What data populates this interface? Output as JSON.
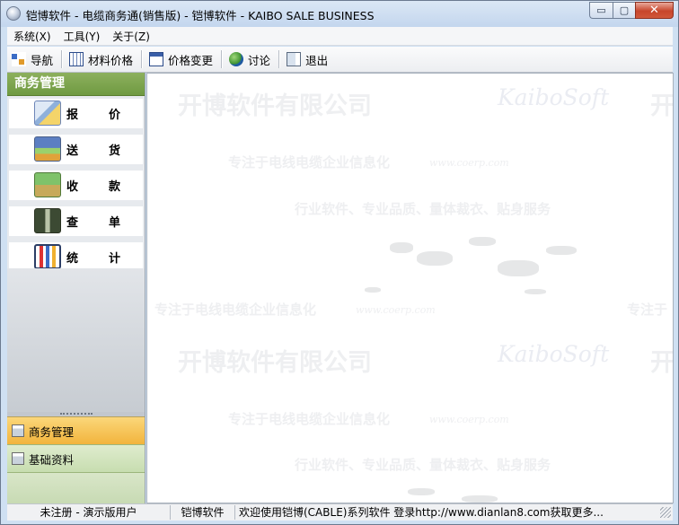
{
  "window": {
    "title": "铠博软件 - 电缆商务通(销售版) - 铠博软件 - KAIBO SALE BUSINESS",
    "min_glyph": "▭",
    "max_glyph": "▢",
    "close_glyph": "✕"
  },
  "menu": [
    "系统(X)",
    "工具(Y)",
    "关于(Z)"
  ],
  "toolbar": [
    {
      "label": "导航",
      "icon": "navigation-icon"
    },
    {
      "label": "材料价格",
      "icon": "grid-icon"
    },
    {
      "label": "价格变更",
      "icon": "table-icon"
    },
    {
      "label": "讨论",
      "icon": "globe-icon"
    },
    {
      "label": "退出",
      "icon": "exit-icon"
    }
  ],
  "left_panel": {
    "header": "商务管理",
    "items": [
      {
        "c1": "报",
        "c2": "价",
        "icon": "quote-icon"
      },
      {
        "c1": "送",
        "c2": "货",
        "icon": "delivery-truck-icon"
      },
      {
        "c1": "收",
        "c2": "款",
        "icon": "cash-icon"
      },
      {
        "c1": "查",
        "c2": "单",
        "icon": "binoculars-icon"
      },
      {
        "c1": "统",
        "c2": "计",
        "icon": "bar-chart-icon"
      }
    ],
    "tabs": [
      {
        "label": "商务管理",
        "active": true
      },
      {
        "label": "基础资料",
        "active": false
      }
    ]
  },
  "watermark": {
    "company": "开博软件有限公司",
    "company_cut": "开",
    "logo": "KaiboSoft",
    "slogan": "专注于电线电缆企业信息化",
    "slogan_cut": "专注于",
    "url": "www.coerp.com",
    "service": "行业软件、专业品质、量体裁衣、贴身服务"
  },
  "status": {
    "registration": "未注册 - 演示版用户",
    "company": "铠博软件",
    "message": "欢迎使用铠博(CABLE)系列软件   登录http://www.dianlan8.com获取更多..."
  }
}
